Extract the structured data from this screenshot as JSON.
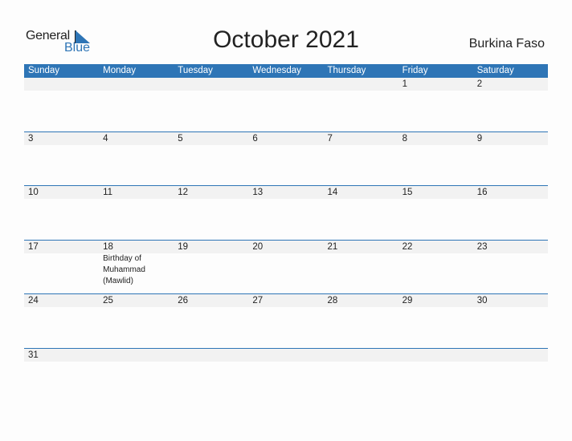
{
  "logo": {
    "general": "General",
    "blue": "Blue"
  },
  "title": "October 2021",
  "country": "Burkina Faso",
  "weekdays": [
    "Sunday",
    "Monday",
    "Tuesday",
    "Wednesday",
    "Thursday",
    "Friday",
    "Saturday"
  ],
  "weeks": [
    [
      "",
      "",
      "",
      "",
      "",
      "1",
      "2"
    ],
    [
      "3",
      "4",
      "5",
      "6",
      "7",
      "8",
      "9"
    ],
    [
      "10",
      "11",
      "12",
      "13",
      "14",
      "15",
      "16"
    ],
    [
      "17",
      "18",
      "19",
      "20",
      "21",
      "22",
      "23"
    ],
    [
      "24",
      "25",
      "26",
      "27",
      "28",
      "29",
      "30"
    ],
    [
      "31",
      "",
      "",
      "",
      "",
      "",
      ""
    ]
  ],
  "events": {
    "18": "Birthday of Muhammad (Mawlid)"
  },
  "colors": {
    "accent": "#2e75b6",
    "strip": "#f2f2f2"
  }
}
